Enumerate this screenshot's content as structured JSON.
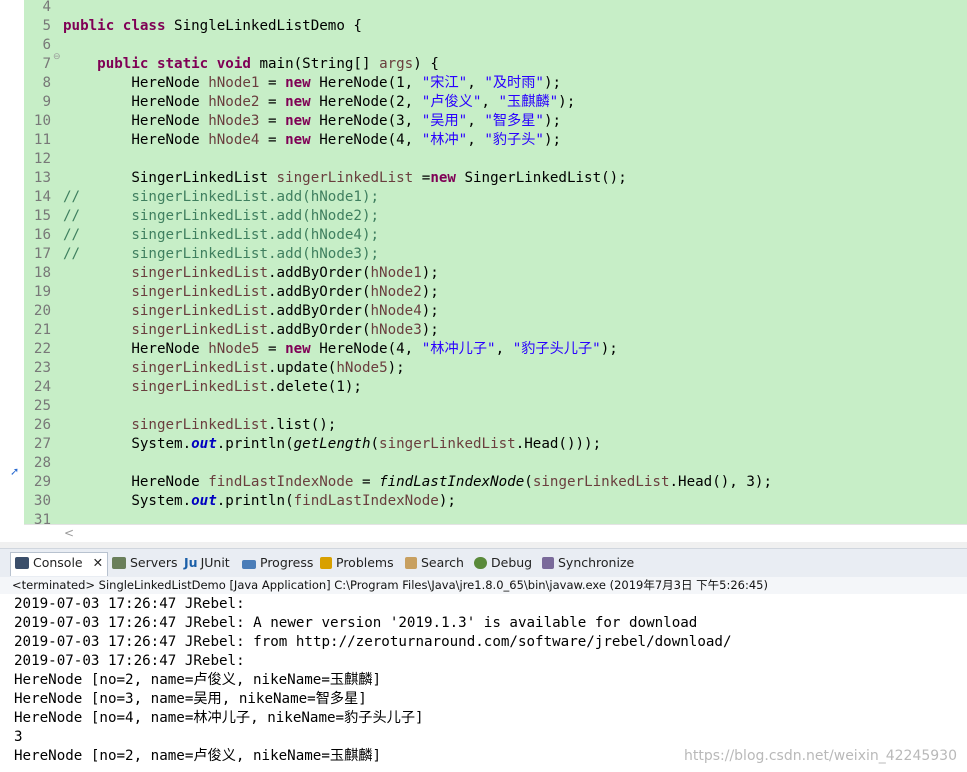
{
  "editor": {
    "lines": [
      {
        "num": "4",
        "text": ""
      },
      {
        "num": "5",
        "text": "public class SingleLinkedListDemo {"
      },
      {
        "num": "6",
        "text": ""
      },
      {
        "num": "7",
        "text": "    public static void main(String[] args) {"
      },
      {
        "num": "8",
        "text": "        HereNode hNode1 = new HereNode(1, \"宋江\", \"及时雨\");"
      },
      {
        "num": "9",
        "text": "        HereNode hNode2 = new HereNode(2, \"卢俊义\", \"玉麒麟\");"
      },
      {
        "num": "10",
        "text": "        HereNode hNode3 = new HereNode(3, \"吴用\", \"智多星\");"
      },
      {
        "num": "11",
        "text": "        HereNode hNode4 = new HereNode(4, \"林冲\", \"豹子头\");"
      },
      {
        "num": "12",
        "text": ""
      },
      {
        "num": "13",
        "text": "        SingerLinkedList singerLinkedList =new SingerLinkedList();"
      },
      {
        "num": "14",
        "text": "//      singerLinkedList.add(hNode1);"
      },
      {
        "num": "15",
        "text": "//      singerLinkedList.add(hNode2);"
      },
      {
        "num": "16",
        "text": "//      singerLinkedList.add(hNode4);"
      },
      {
        "num": "17",
        "text": "//      singerLinkedList.add(hNode3);"
      },
      {
        "num": "18",
        "text": "        singerLinkedList.addByOrder(hNode1);"
      },
      {
        "num": "19",
        "text": "        singerLinkedList.addByOrder(hNode2);"
      },
      {
        "num": "20",
        "text": "        singerLinkedList.addByOrder(hNode4);"
      },
      {
        "num": "21",
        "text": "        singerLinkedList.addByOrder(hNode3);"
      },
      {
        "num": "22",
        "text": "        HereNode hNode5 = new HereNode(4, \"林冲儿子\", \"豹子头儿子\");"
      },
      {
        "num": "23",
        "text": "        singerLinkedList.update(hNode5);"
      },
      {
        "num": "24",
        "text": "        singerLinkedList.delete(1);"
      },
      {
        "num": "25",
        "text": ""
      },
      {
        "num": "26",
        "text": "        singerLinkedList.list();"
      },
      {
        "num": "27",
        "text": "        System.out.println(getLength(singerLinkedList.Head()));"
      },
      {
        "num": "28",
        "text": ""
      },
      {
        "num": "29",
        "text": "        HereNode findLastIndexNode = findLastIndexNode(singerLinkedList.Head(), 3);"
      },
      {
        "num": "30",
        "text": "        System.out.println(findLastIndexNode);"
      },
      {
        "num": "31",
        "text": ""
      }
    ],
    "scroll_arrow": "<"
  },
  "tabs": [
    {
      "label": "Console",
      "icon": "console-icon",
      "close": "✕",
      "active": true
    },
    {
      "label": "Servers",
      "icon": "servers-icon",
      "active": false
    },
    {
      "label": "JUnit",
      "icon": "junit-icon",
      "prefix": "Ju",
      "active": false
    },
    {
      "label": "Progress",
      "icon": "progress-icon",
      "active": false
    },
    {
      "label": "Problems",
      "icon": "problems-icon",
      "active": false
    },
    {
      "label": "Search",
      "icon": "search-icon",
      "active": false
    },
    {
      "label": "Debug",
      "icon": "debug-icon",
      "active": false
    },
    {
      "label": "Synchronize",
      "icon": "synchronize-icon",
      "active": false
    }
  ],
  "status_line": "<terminated> SingleLinkedListDemo [Java Application] C:\\Program Files\\Java\\jre1.8.0_65\\bin\\javaw.exe (2019年7月3日 下午5:26:45)",
  "console": [
    "2019-07-03 17:26:47 JRebel:",
    "2019-07-03 17:26:47 JRebel: A newer version '2019.1.3' is available for download",
    "2019-07-03 17:26:47 JRebel: from http://zeroturnaround.com/software/jrebel/download/",
    "2019-07-03 17:26:47 JRebel:",
    "HereNode [no=2, name=卢俊义, nikeName=玉麒麟]",
    "HereNode [no=3, name=吴用, nikeName=智多星]",
    "HereNode [no=4, name=林冲儿子, nikeName=豹子头儿子]",
    "3",
    "HereNode [no=2, name=卢俊义, nikeName=玉麒麟]"
  ],
  "watermark": "https://blog.csdn.net/weixin_42245930",
  "colors": {
    "editor_bg": "#c7eec7",
    "keyword": "#7f0055",
    "string": "#2a00ff",
    "comment": "#3f7f5f"
  }
}
